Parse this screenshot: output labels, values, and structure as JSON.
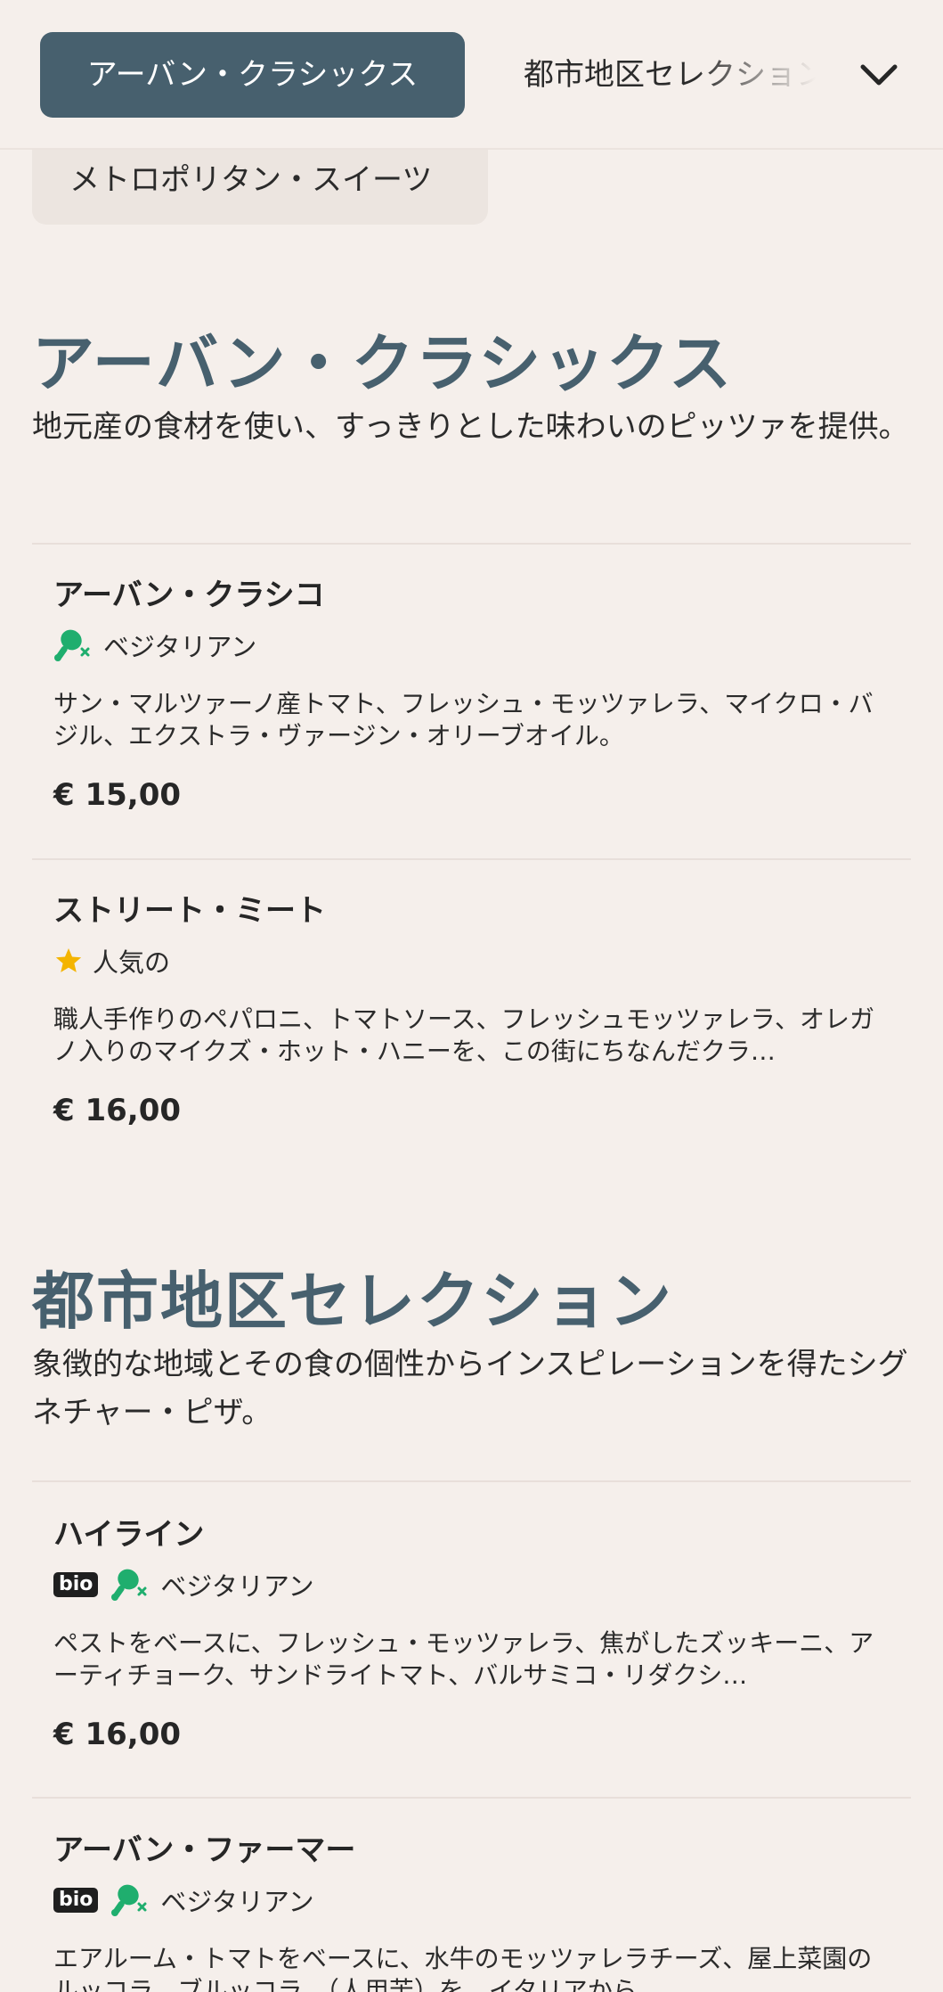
{
  "category_bar": {
    "active_label": "アーバン・クラシックス",
    "next_label": "都市地区セレクション",
    "hidden_label": "メトロポリタン・スイーツ",
    "toggle_icon": "chevron-down-icon"
  },
  "sections": [
    {
      "title": "アーバン・クラシックス",
      "description": "地元産の食材を使い、すっきりとした味わいのピッツァを提供。",
      "items": [
        {
          "name": "アーバン・クラシコ",
          "badge": "",
          "tag_icon": "vegetarian-drumstick-crossed-icon",
          "tag_label": "ベジタリアン",
          "description": "サン・マルツァーノ産トマト、フレッシュ・モッツァレラ、マイクロ・バジル、エクストラ・ヴァージン・オリーブオイル。",
          "price": "€ 15,00"
        },
        {
          "name": "ストリート・ミート",
          "badge": "",
          "tag_icon": "star-icon",
          "tag_label": "人気の",
          "description": "職人手作りのペパロニ、トマトソース、フレッシュモッツァレラ、オレガノ入りのマイクズ・ホット・ハニーを、この街にちなんだクラ…",
          "price": "€ 16,00"
        }
      ]
    },
    {
      "title": "都市地区セレクション",
      "description": "象徴的な地域とその食の個性からインスピレーションを得たシグネチャー・ピザ。",
      "items": [
        {
          "name": "ハイライン",
          "badge": "bio",
          "tag_icon": "vegetarian-drumstick-crossed-icon",
          "tag_label": "ベジタリアン",
          "description": "ペストをベースに、フレッシュ・モッツァレラ、焦がしたズッキーニ、アーティチョーク、サンドライトマト、バルサミコ・リダクシ…",
          "price": "€ 16,00"
        },
        {
          "name": "アーバン・ファーマー",
          "badge": "bio",
          "tag_icon": "vegetarian-drumstick-crossed-icon",
          "tag_label": "ベジタリアン",
          "description": "エアルーム・トマトをベースに、水牛のモッツァレラチーズ、屋上菜園のルッコラ、ブルッコラ、（人用苦）を、イタリアから…",
          "price": ""
        }
      ]
    }
  ],
  "colors": {
    "background": "#f5efeb",
    "accent": "#47606e",
    "vegetarian_green": "#1fae6e",
    "star_yellow": "#f4b400",
    "text": "#262626"
  }
}
